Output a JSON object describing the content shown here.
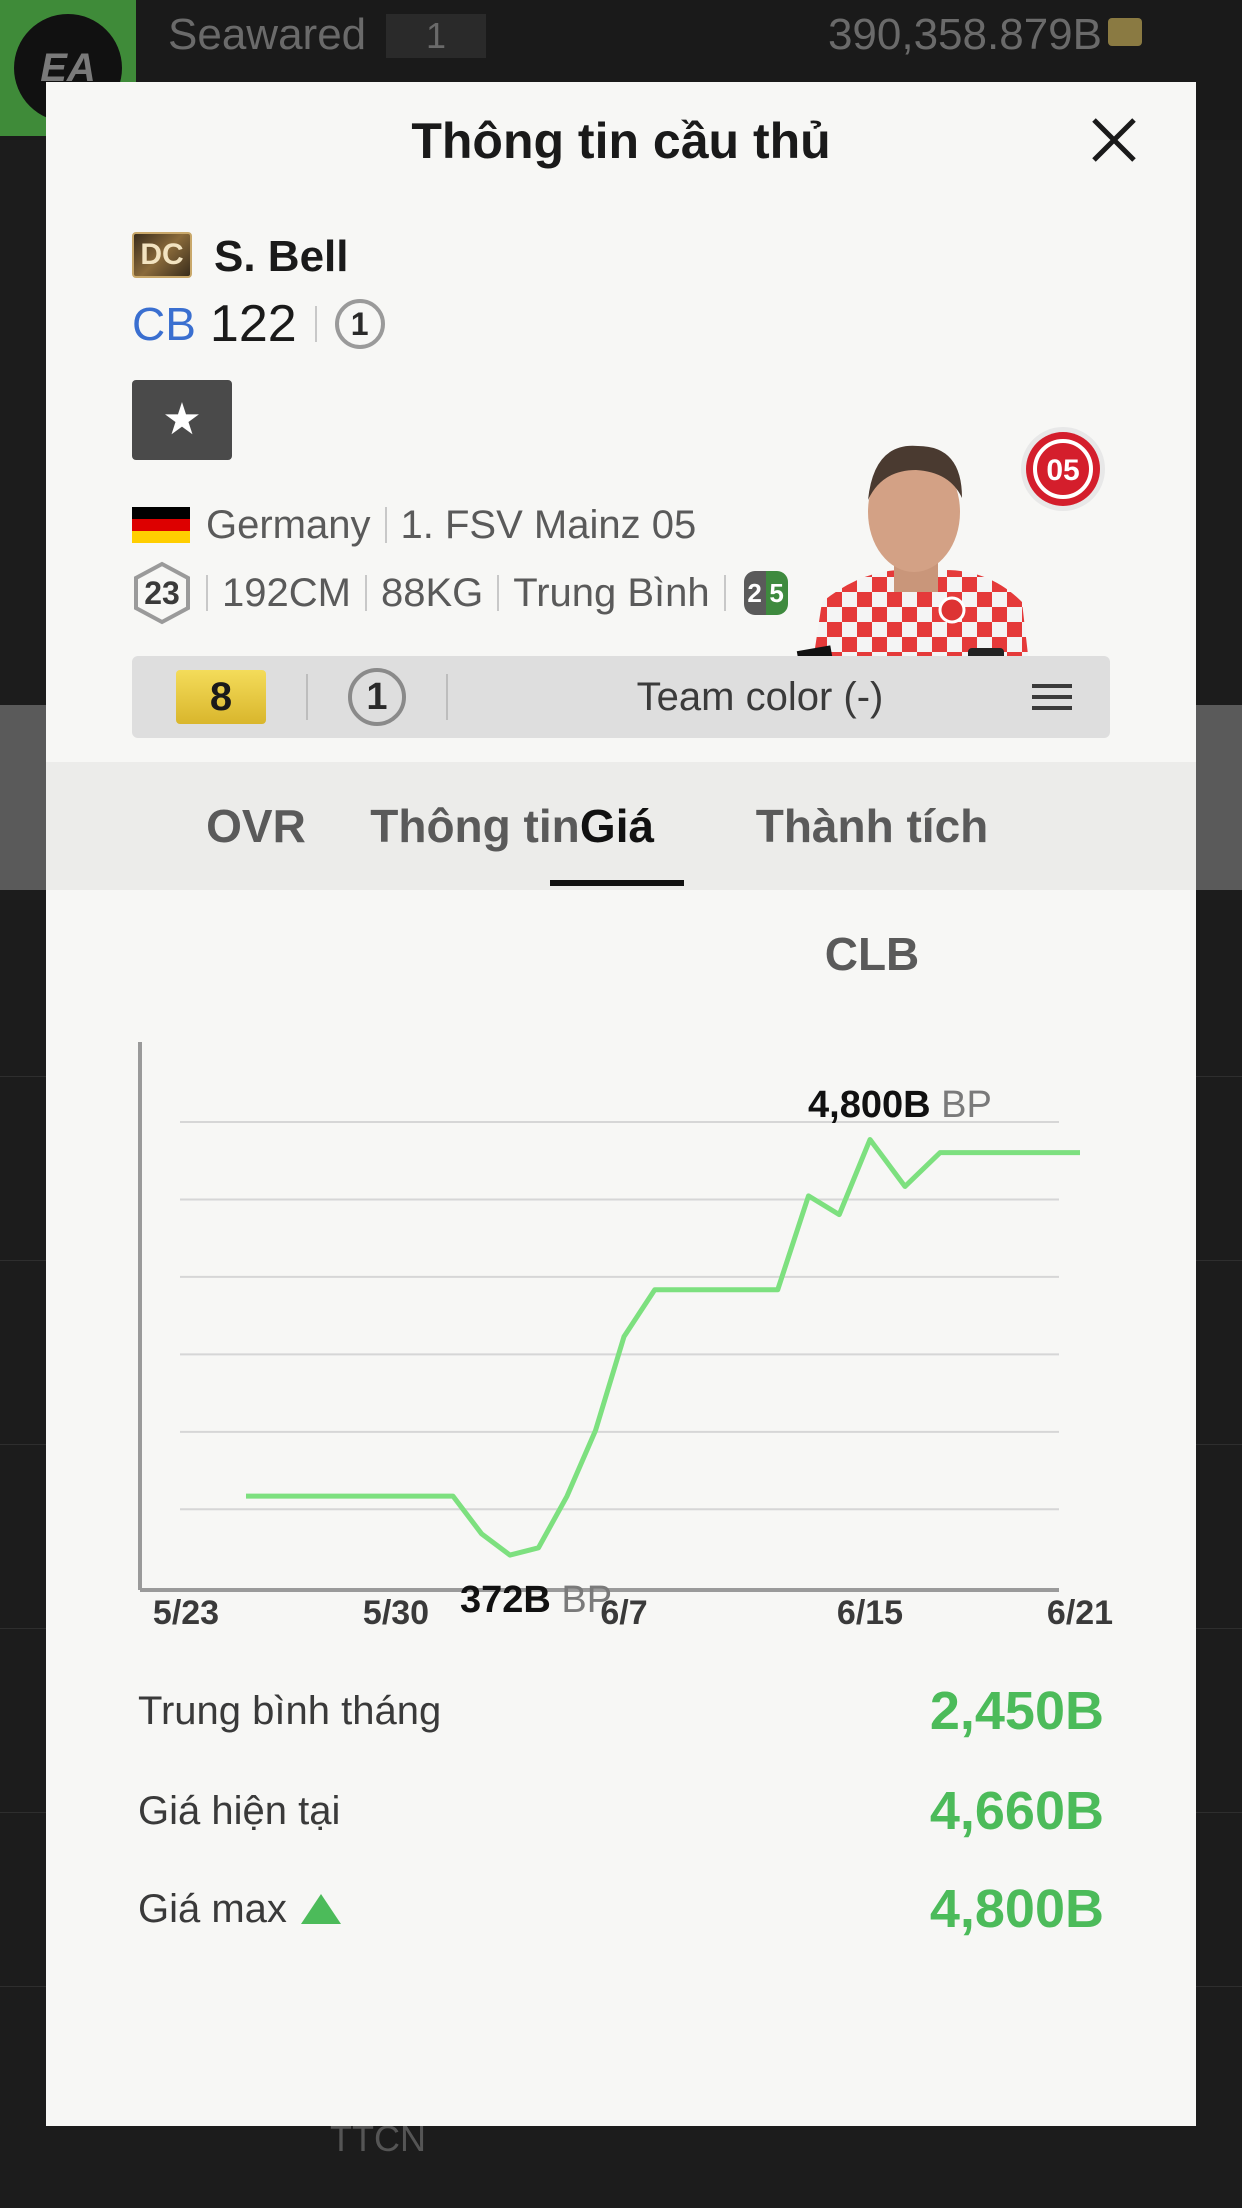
{
  "background": {
    "username": "Seawared",
    "level": "1",
    "coins": "390,358.879B",
    "bottom_nav_label": "TTCN"
  },
  "modal": {
    "title": "Thông tin cầu thủ"
  },
  "player": {
    "season_badge": "DC",
    "name": "S. Bell",
    "position": "CB",
    "ovr": "122",
    "upgrade_rank": "1",
    "nation": "Germany",
    "club": "1. FSV Mainz 05",
    "age": "23",
    "height": "192CM",
    "weight": "88KG",
    "body_type": "Trung Bình",
    "skill_left": "2",
    "skill_right": "5",
    "flag_colors": [
      "#000000",
      "#dd0000",
      "#ffce00"
    ]
  },
  "enhancement": {
    "level": "8",
    "rank": "1",
    "team_color": "Team color (-)"
  },
  "tabs": [
    {
      "label": "OVR"
    },
    {
      "label": "Thông tin"
    },
    {
      "label": "Giá"
    },
    {
      "label": "Thành tích CLB"
    }
  ],
  "active_tab": "Giá",
  "chart_data": {
    "type": "line",
    "x_tick_labels": [
      "5/23",
      "5/30",
      "6/7",
      "6/15",
      "6/21"
    ],
    "x": [
      "5/25",
      "5/26",
      "5/27",
      "5/28",
      "5/29",
      "5/30",
      "5/31",
      "6/1",
      "6/2",
      "6/3",
      "6/4",
      "6/5",
      "6/6",
      "6/7",
      "6/8",
      "6/9",
      "6/10",
      "6/11",
      "6/12",
      "6/13",
      "6/14",
      "6/15",
      "6/16",
      "6/17",
      "6/18",
      "6/19",
      "6/20",
      "6/21"
    ],
    "values": [
      1000,
      1000,
      1000,
      1000,
      1000,
      1000,
      1000,
      1000,
      600,
      372,
      450,
      1000,
      1700,
      2700,
      3200,
      3200,
      3200,
      3200,
      3200,
      4200,
      4000,
      4800,
      4300,
      4660,
      4660,
      4660,
      4660,
      4660
    ],
    "ylim": [
      0,
      5200
    ],
    "grid": true,
    "line_color": "#7de07f",
    "annotations": {
      "max_value": "4,800B",
      "min_value": "372B",
      "unit": "BP"
    }
  },
  "summary": {
    "monthly_avg_label": "Trung bình tháng",
    "monthly_avg_value": "2,450B",
    "current_price_label": "Giá hiện tại",
    "current_price_value": "4,660B",
    "max_price_label": "Giá max",
    "max_price_value": "4,800B",
    "value_color": "#4cbb5a"
  }
}
